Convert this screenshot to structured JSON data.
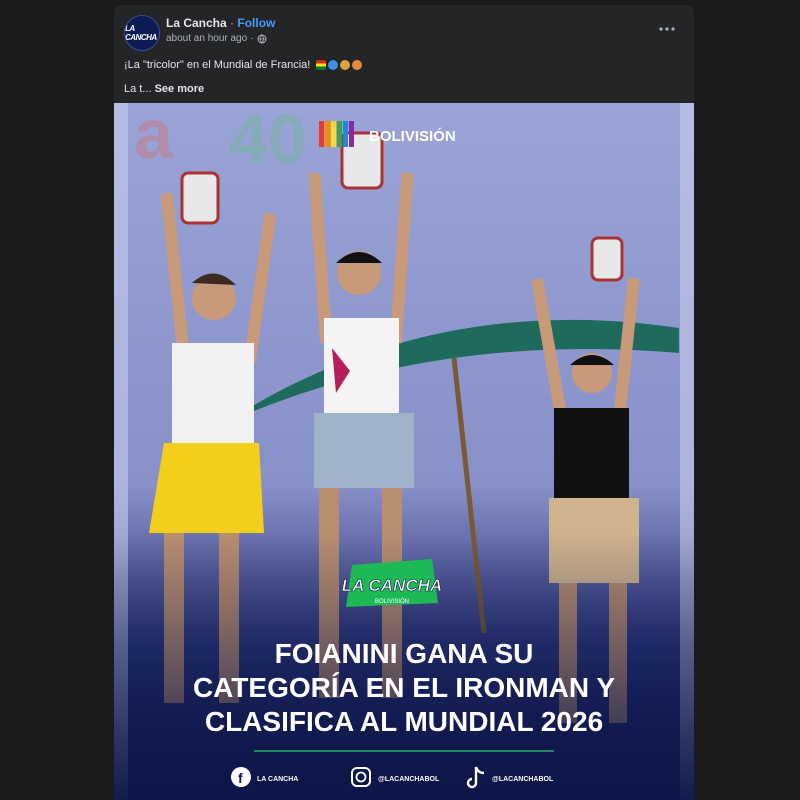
{
  "post": {
    "page_name": "La Cancha",
    "separator": "·",
    "follow_label": "Follow",
    "time": "about an hour ago",
    "avatar_text": "LA CANCHA",
    "caption_line1": "¡La \"tricolor\" en el Mundial de Francia!",
    "caption_line2": "La t...",
    "see_more": "See more",
    "icons": [
      "more-options-icon",
      "globe-icon",
      "bolivia-flag-emoji",
      "wave-emoji",
      "cyclist-emoji",
      "runner-emoji"
    ]
  },
  "image": {
    "broadcaster": "BOLIVISIÓN",
    "logo_main": "LA CANCHA",
    "logo_sub": "BOLIVISIÓN",
    "headline_line1": "FOIANINI GANA SU",
    "headline_line2": "CATEGORÍA EN EL IRONMAN Y",
    "headline_line3": "CLASIFICA AL MUNDIAL 2026",
    "social_facebook": "LA CANCHA",
    "social_instagram": "@LACANCHABOL",
    "social_tiktok": "@LACANCHABOL",
    "colors": {
      "accent": "#4599ff",
      "bg": "#242526",
      "headline": "#ffffff",
      "logo_green": "#2fd36a",
      "navy": "#0f1a52"
    }
  }
}
